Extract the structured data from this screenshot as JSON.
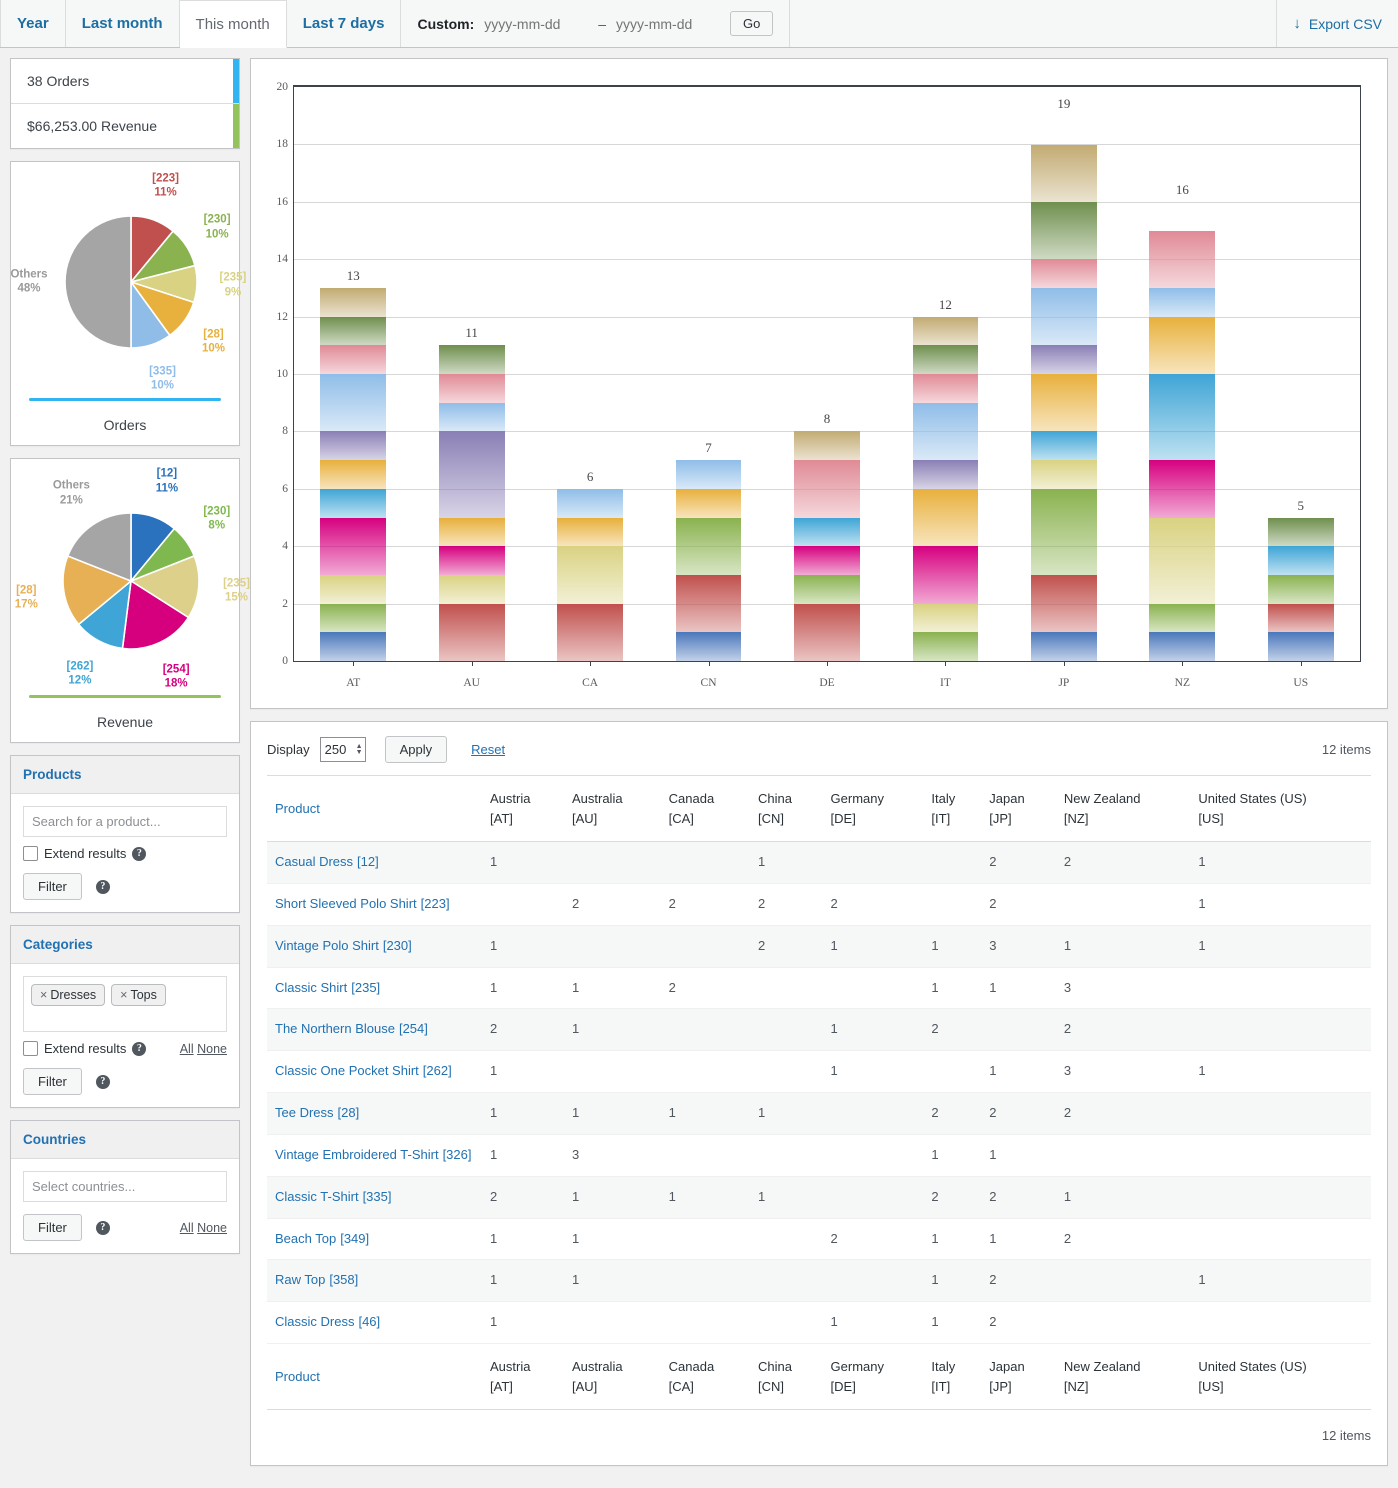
{
  "topbar": {
    "tabs": [
      {
        "label": "Year",
        "active": false
      },
      {
        "label": "Last month",
        "active": false
      },
      {
        "label": "This month",
        "active": true
      },
      {
        "label": "Last 7 days",
        "active": false
      }
    ],
    "custom_label": "Custom:",
    "date_from_placeholder": "yyyy-mm-dd",
    "date_to_placeholder": "yyyy-mm-dd",
    "date_from_value": "",
    "date_to_value": "",
    "dash": "–",
    "go_label": "Go",
    "export_label": "Export CSV",
    "export_icon": "download-icon"
  },
  "summary": {
    "orders": "38 Orders",
    "revenue": "$66,253.00 Revenue",
    "orders_accent": "#33b4f2",
    "revenue_accent": "#92c35c"
  },
  "pies": [
    {
      "title": "Orders",
      "rule_color": "#33b4f2",
      "slices": [
        {
          "label": "[223]",
          "pct": "11%",
          "value": 11,
          "color": "#c0504d"
        },
        {
          "label": "[230]",
          "pct": "10%",
          "value": 10,
          "color": "#8ab24f"
        },
        {
          "label": "[235]",
          "pct": "9%",
          "value": 9,
          "color": "#d9d282"
        },
        {
          "label": "[28]",
          "pct": "10%",
          "value": 10,
          "color": "#e8b03c"
        },
        {
          "label": "[335]",
          "pct": "10%",
          "value": 10,
          "color": "#8fbde8"
        },
        {
          "label": "Others",
          "pct": "48%",
          "value": 50,
          "color": "#a5a5a5"
        }
      ]
    },
    {
      "title": "Revenue",
      "rule_color": "#92c35c",
      "slices": [
        {
          "label": "[12]",
          "pct": "11%",
          "value": 11,
          "color": "#2a72bd"
        },
        {
          "label": "[230]",
          "pct": "8%",
          "value": 8,
          "color": "#7fb84e"
        },
        {
          "label": "[235]",
          "pct": "15%",
          "value": 15,
          "color": "#ddd08a"
        },
        {
          "label": "[254]",
          "pct": "18%",
          "value": 18,
          "color": "#d6007f"
        },
        {
          "label": "[262]",
          "pct": "12%",
          "value": 12,
          "color": "#3ea5d6"
        },
        {
          "label": "[28]",
          "pct": "17%",
          "value": 17,
          "color": "#e7b055"
        },
        {
          "label": "Others",
          "pct": "21%",
          "value": 19,
          "color": "#a5a5a5"
        }
      ]
    }
  ],
  "widgets": {
    "products": {
      "title": "Products",
      "search_placeholder": "Search for a product...",
      "search_value": "",
      "extend_label": "Extend results",
      "filter_label": "Filter"
    },
    "categories": {
      "title": "Categories",
      "tokens": [
        "Dresses",
        "Tops"
      ],
      "token_x": "×",
      "extend_label": "Extend results",
      "filter_label": "Filter",
      "all_label": "All",
      "none_label": "None"
    },
    "countries": {
      "title": "Countries",
      "search_placeholder": "Select countries...",
      "search_value": "",
      "filter_label": "Filter",
      "all_label": "All",
      "none_label": "None"
    }
  },
  "table_controls": {
    "display_label": "Display",
    "display_value": "250",
    "apply_label": "Apply",
    "reset_label": "Reset",
    "items_top": "12 items",
    "items_bottom": "12 items"
  },
  "table": {
    "headers": [
      {
        "line1": "Product",
        "line2": ""
      },
      {
        "line1": "Austria",
        "line2": "[AT]"
      },
      {
        "line1": "Australia",
        "line2": "[AU]"
      },
      {
        "line1": "Canada",
        "line2": "[CA]"
      },
      {
        "line1": "China",
        "line2": "[CN]"
      },
      {
        "line1": "Germany",
        "line2": "[DE]"
      },
      {
        "line1": "Italy",
        "line2": "[IT]"
      },
      {
        "line1": "Japan",
        "line2": "[JP]"
      },
      {
        "line1": "New Zealand",
        "line2": "[NZ]"
      },
      {
        "line1": "United States (US)",
        "line2": "[US]"
      }
    ],
    "rows": [
      {
        "name": "Casual Dress",
        "id": "[12]",
        "cells": [
          "1",
          "",
          "",
          "1",
          "",
          "",
          "2",
          "2",
          "1"
        ]
      },
      {
        "name": "Short Sleeved Polo Shirt",
        "id": "[223]",
        "cells": [
          "",
          "2",
          "2",
          "2",
          "2",
          "",
          "2",
          "",
          "1"
        ]
      },
      {
        "name": "Vintage Polo Shirt",
        "id": "[230]",
        "cells": [
          "1",
          "",
          "",
          "2",
          "1",
          "1",
          "3",
          "1",
          "1"
        ]
      },
      {
        "name": "Classic Shirt",
        "id": "[235]",
        "cells": [
          "1",
          "1",
          "2",
          "",
          "",
          "1",
          "1",
          "3",
          ""
        ]
      },
      {
        "name": "The Northern Blouse",
        "id": "[254]",
        "cells": [
          "2",
          "1",
          "",
          "",
          "1",
          "2",
          "",
          "2",
          ""
        ]
      },
      {
        "name": "Classic One Pocket Shirt",
        "id": "[262]",
        "cells": [
          "1",
          "",
          "",
          "",
          "1",
          "",
          "1",
          "3",
          "1"
        ]
      },
      {
        "name": "Tee Dress",
        "id": "[28]",
        "cells": [
          "1",
          "1",
          "1",
          "1",
          "",
          "2",
          "2",
          "2",
          ""
        ]
      },
      {
        "name": "Vintage Embroidered T-Shirt",
        "id": "[326]",
        "cells": [
          "1",
          "3",
          "",
          "",
          "",
          "1",
          "1",
          "",
          ""
        ]
      },
      {
        "name": "Classic T-Shirt",
        "id": "[335]",
        "cells": [
          "2",
          "1",
          "1",
          "1",
          "",
          "2",
          "2",
          "1",
          ""
        ]
      },
      {
        "name": "Beach Top",
        "id": "[349]",
        "cells": [
          "1",
          "1",
          "",
          "",
          "2",
          "1",
          "1",
          "2",
          ""
        ]
      },
      {
        "name": "Raw Top",
        "id": "[358]",
        "cells": [
          "1",
          "1",
          "",
          "",
          "",
          "1",
          "2",
          "",
          "1"
        ]
      },
      {
        "name": "Classic Dress",
        "id": "[46]",
        "cells": [
          "1",
          "",
          "",
          "",
          "1",
          "1",
          "2",
          "",
          ""
        ]
      }
    ]
  },
  "chart_data": {
    "type": "bar",
    "stacked": true,
    "title": "",
    "xlabel": "",
    "ylabel": "",
    "ylim": [
      0,
      20
    ],
    "yticks": [
      0,
      2,
      4,
      6,
      8,
      10,
      12,
      14,
      16,
      18,
      20
    ],
    "grid": true,
    "legend": "none",
    "categories": [
      "AT",
      "AU",
      "CA",
      "CN",
      "DE",
      "IT",
      "JP",
      "NZ",
      "US"
    ],
    "totals": [
      13,
      11,
      6,
      7,
      8,
      12,
      19,
      16,
      5
    ],
    "series": [
      {
        "name": "Casual Dress [12]",
        "color": "#4a77bb",
        "values": [
          1,
          0,
          0,
          1,
          0,
          0,
          1,
          1,
          1
        ]
      },
      {
        "name": "Short Sleeved Polo Shirt [223]",
        "color": "#c0504d",
        "values": [
          0,
          2,
          2,
          2,
          2,
          0,
          2,
          0,
          1
        ]
      },
      {
        "name": "Vintage Polo Shirt [230]",
        "color": "#8ab24f",
        "values": [
          1,
          0,
          0,
          2,
          1,
          1,
          3,
          1,
          1
        ]
      },
      {
        "name": "Classic Shirt [235]",
        "color": "#d9d282",
        "values": [
          1,
          1,
          2,
          0,
          0,
          1,
          1,
          3,
          0
        ]
      },
      {
        "name": "The Northern Blouse [254]",
        "color": "#d6007f",
        "values": [
          2,
          1,
          0,
          0,
          1,
          2,
          0,
          2,
          0
        ]
      },
      {
        "name": "Classic One Pocket Shirt [262]",
        "color": "#3ea5d6",
        "values": [
          1,
          0,
          0,
          0,
          1,
          0,
          1,
          3,
          1
        ]
      },
      {
        "name": "Tee Dress [28]",
        "color": "#e8b03c",
        "values": [
          1,
          1,
          1,
          1,
          0,
          2,
          2,
          2,
          0
        ]
      },
      {
        "name": "Vintage Embroidered T-Shirt [326]",
        "color": "#8a7fb5",
        "values": [
          1,
          3,
          0,
          0,
          0,
          1,
          1,
          0,
          0
        ]
      },
      {
        "name": "Classic T-Shirt [335]",
        "color": "#8fbde8",
        "values": [
          2,
          1,
          1,
          1,
          0,
          2,
          2,
          1,
          0
        ]
      },
      {
        "name": "Beach Top [349]",
        "color": "#e08a96",
        "values": [
          1,
          1,
          0,
          0,
          2,
          1,
          1,
          2,
          0
        ]
      },
      {
        "name": "Raw Top [358]",
        "color": "#6f8f4e",
        "values": [
          1,
          1,
          0,
          0,
          0,
          1,
          2,
          0,
          1
        ]
      },
      {
        "name": "Classic Dress [46]",
        "color": "#c2ab72",
        "values": [
          1,
          0,
          0,
          0,
          1,
          1,
          2,
          0,
          0
        ]
      }
    ]
  }
}
